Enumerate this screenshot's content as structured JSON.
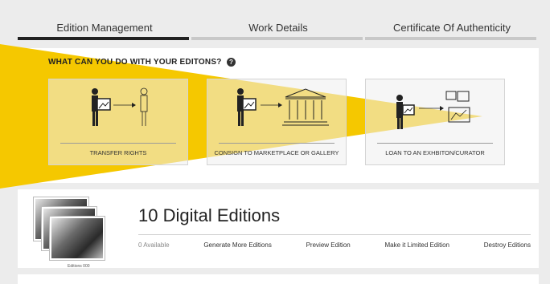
{
  "tabs": [
    {
      "label": "Edition Management",
      "active": true
    },
    {
      "label": "Work Details",
      "active": false
    },
    {
      "label": "Certificate Of Authenticity",
      "active": false
    }
  ],
  "options_panel": {
    "title": "WHAT CAN YOU DO WITH YOUR EDITONS?",
    "help_icon": "?",
    "options": [
      {
        "label": "TRANSFER RIGHTS",
        "icon": "transfer-rights-icon"
      },
      {
        "label": "CONSIGN TO MARKETPLACE OR GALLERY",
        "icon": "consign-gallery-icon"
      },
      {
        "label": "LOAN TO AN EXHBITON/CURATOR",
        "icon": "loan-exhibition-icon"
      }
    ]
  },
  "edition": {
    "title": "10 Digital Editions",
    "thumbnail_caption": "Editions 000",
    "available": "0 Available",
    "actions": [
      "Generate More Editions",
      "Preview Edition",
      "Make it Limited Edition",
      "Destroy Editions"
    ]
  },
  "colors": {
    "accent": "#f5c800",
    "active_tab": "#222222",
    "inactive_tab": "#c8c8c8"
  }
}
